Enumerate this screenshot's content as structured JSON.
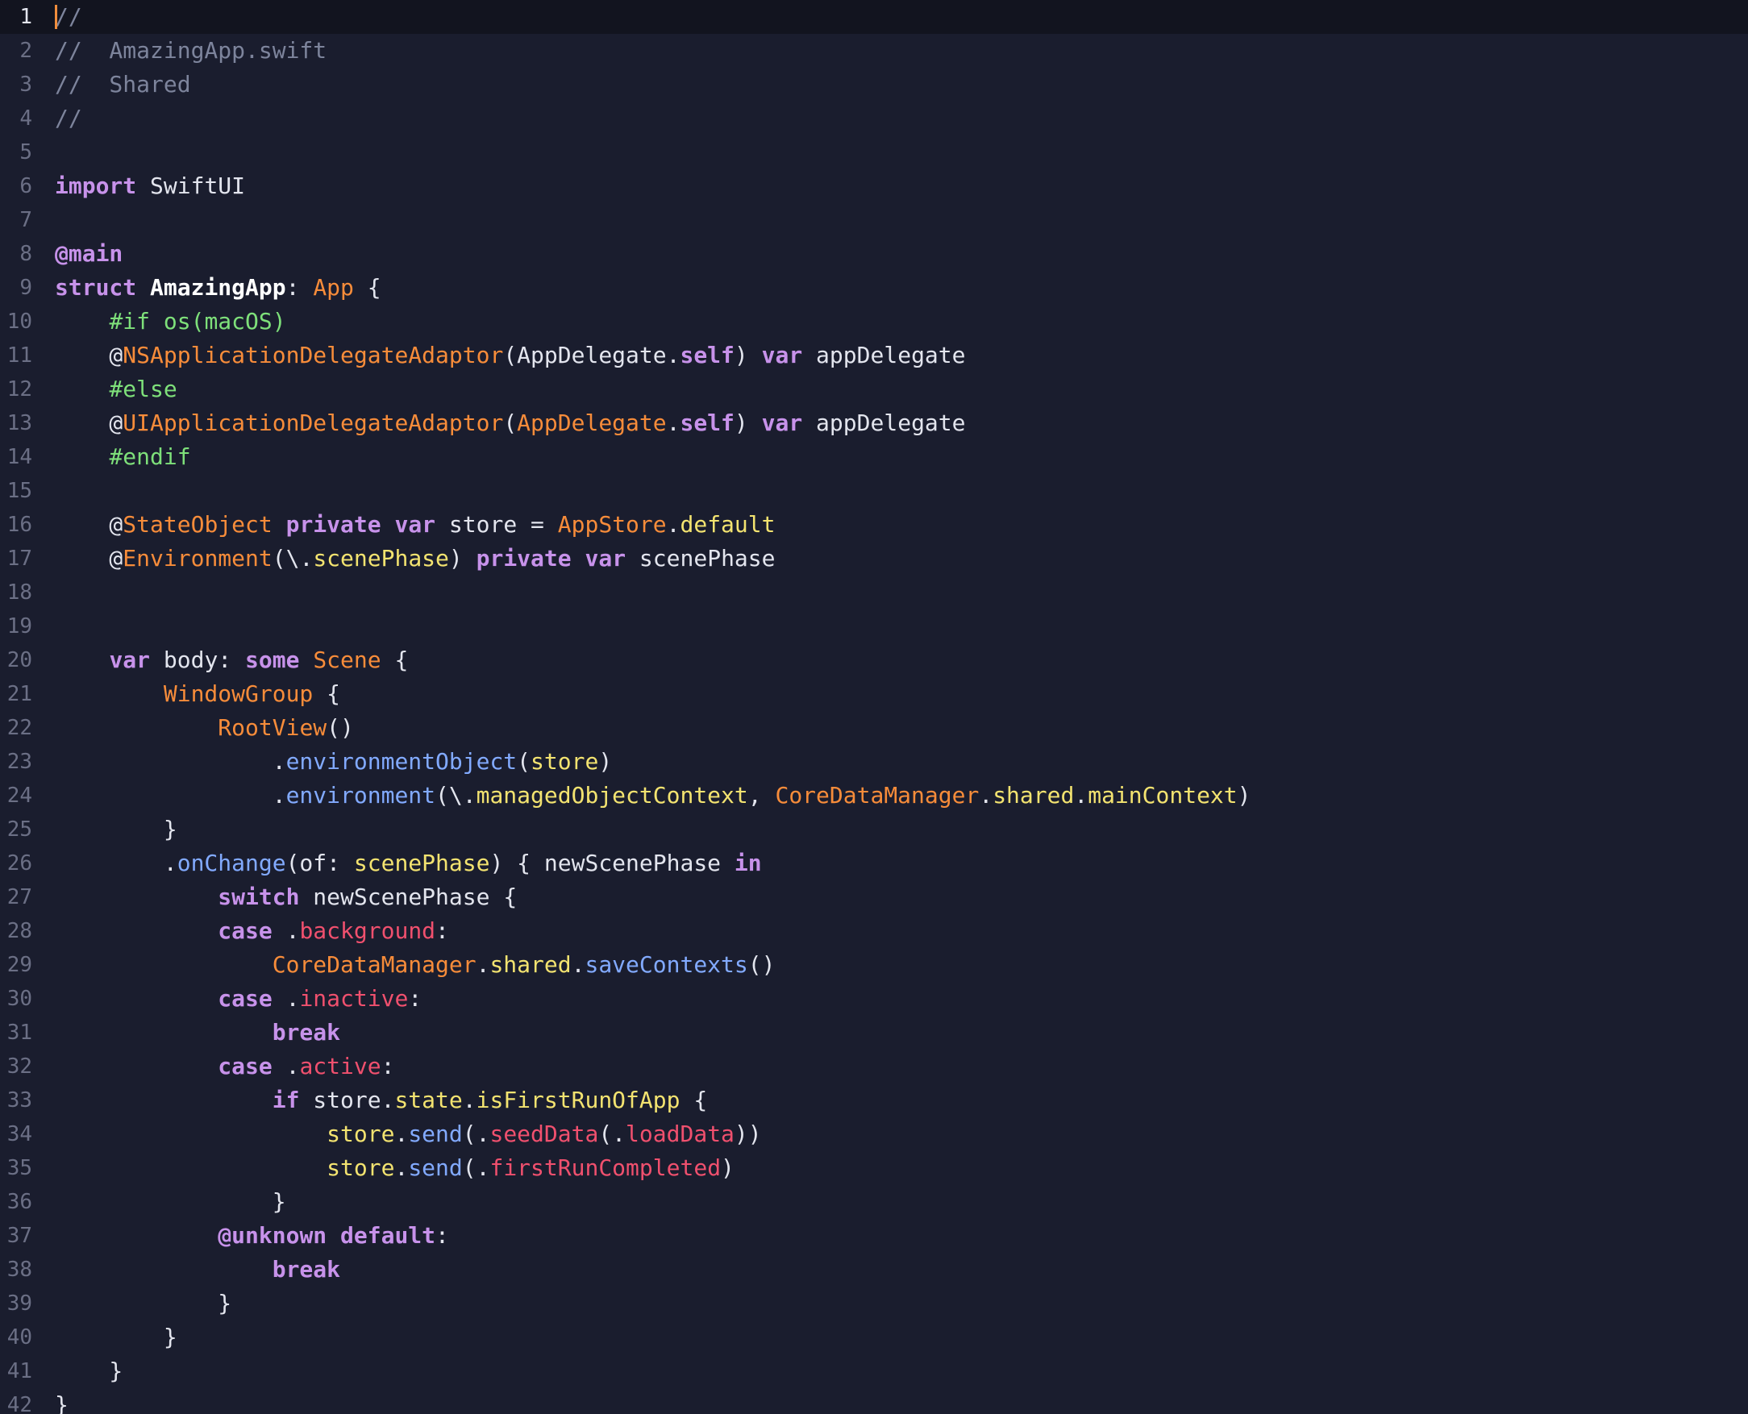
{
  "editor": {
    "file": "AmazingApp.swift",
    "current_line": 1,
    "colors": {
      "background": "#1a1d2e",
      "current_line_background": "#12141f",
      "comment": "#7d849c",
      "keyword": "#c792ea",
      "type": "#f78c3a",
      "property": "#f3e370",
      "function": "#82aaff",
      "enum_case": "#f0506e",
      "preprocessor": "#7ee07a",
      "plain": "#e3e5ee"
    },
    "lines": [
      {
        "num": "1",
        "tokens": [
          {
            "t": "//",
            "c": "comment"
          }
        ]
      },
      {
        "num": "2",
        "tokens": [
          {
            "t": "//  AmazingApp.swift",
            "c": "comment"
          }
        ]
      },
      {
        "num": "3",
        "tokens": [
          {
            "t": "//  Shared",
            "c": "comment"
          }
        ]
      },
      {
        "num": "4",
        "tokens": [
          {
            "t": "//",
            "c": "comment"
          }
        ]
      },
      {
        "num": "5",
        "tokens": []
      },
      {
        "num": "6",
        "tokens": [
          {
            "t": "import",
            "c": "kw"
          },
          {
            "t": " SwiftUI",
            "c": "plain"
          }
        ]
      },
      {
        "num": "7",
        "tokens": []
      },
      {
        "num": "8",
        "tokens": [
          {
            "t": "@main",
            "c": "kw"
          }
        ]
      },
      {
        "num": "9",
        "tokens": [
          {
            "t": "struct",
            "c": "kw"
          },
          {
            "t": " ",
            "c": "plain"
          },
          {
            "t": "AmazingApp",
            "c": "decl"
          },
          {
            "t": ": ",
            "c": "plain"
          },
          {
            "t": "App",
            "c": "type"
          },
          {
            "t": " {",
            "c": "plain"
          }
        ]
      },
      {
        "num": "10",
        "tokens": [
          {
            "t": "    ",
            "c": "plain"
          },
          {
            "t": "#if",
            "c": "pre"
          },
          {
            "t": " ",
            "c": "plain"
          },
          {
            "t": "os(macOS)",
            "c": "pre"
          }
        ]
      },
      {
        "num": "11",
        "tokens": [
          {
            "t": "    @",
            "c": "plain"
          },
          {
            "t": "NSApplicationDelegateAdaptor",
            "c": "type"
          },
          {
            "t": "(AppDelegate.",
            "c": "plain"
          },
          {
            "t": "self",
            "c": "kw"
          },
          {
            "t": ") ",
            "c": "plain"
          },
          {
            "t": "var",
            "c": "kw"
          },
          {
            "t": " appDelegate",
            "c": "plain"
          }
        ]
      },
      {
        "num": "12",
        "tokens": [
          {
            "t": "    ",
            "c": "plain"
          },
          {
            "t": "#else",
            "c": "pre"
          }
        ]
      },
      {
        "num": "13",
        "tokens": [
          {
            "t": "    @",
            "c": "plain"
          },
          {
            "t": "UIApplicationDelegateAdaptor",
            "c": "type"
          },
          {
            "t": "(",
            "c": "plain"
          },
          {
            "t": "AppDelegate",
            "c": "type"
          },
          {
            "t": ".",
            "c": "plain"
          },
          {
            "t": "self",
            "c": "kw"
          },
          {
            "t": ") ",
            "c": "plain"
          },
          {
            "t": "var",
            "c": "kw"
          },
          {
            "t": " appDelegate",
            "c": "plain"
          }
        ]
      },
      {
        "num": "14",
        "tokens": [
          {
            "t": "    ",
            "c": "plain"
          },
          {
            "t": "#endif",
            "c": "pre"
          }
        ]
      },
      {
        "num": "15",
        "tokens": []
      },
      {
        "num": "16",
        "tokens": [
          {
            "t": "    @",
            "c": "plain"
          },
          {
            "t": "StateObject",
            "c": "type"
          },
          {
            "t": " ",
            "c": "plain"
          },
          {
            "t": "private",
            "c": "kw"
          },
          {
            "t": " ",
            "c": "plain"
          },
          {
            "t": "var",
            "c": "kw"
          },
          {
            "t": " store = ",
            "c": "plain"
          },
          {
            "t": "AppStore",
            "c": "type"
          },
          {
            "t": ".",
            "c": "plain"
          },
          {
            "t": "default",
            "c": "prop"
          }
        ]
      },
      {
        "num": "17",
        "tokens": [
          {
            "t": "    @",
            "c": "plain"
          },
          {
            "t": "Environment",
            "c": "type"
          },
          {
            "t": "(\\.",
            "c": "plain"
          },
          {
            "t": "scenePhase",
            "c": "prop"
          },
          {
            "t": ") ",
            "c": "plain"
          },
          {
            "t": "private",
            "c": "kw"
          },
          {
            "t": " ",
            "c": "plain"
          },
          {
            "t": "var",
            "c": "kw"
          },
          {
            "t": " scenePhase",
            "c": "plain"
          }
        ]
      },
      {
        "num": "18",
        "tokens": []
      },
      {
        "num": "19",
        "tokens": []
      },
      {
        "num": "20",
        "tokens": [
          {
            "t": "    ",
            "c": "plain"
          },
          {
            "t": "var",
            "c": "kw"
          },
          {
            "t": " body: ",
            "c": "plain"
          },
          {
            "t": "some",
            "c": "kw"
          },
          {
            "t": " ",
            "c": "plain"
          },
          {
            "t": "Scene",
            "c": "type"
          },
          {
            "t": " {",
            "c": "plain"
          }
        ]
      },
      {
        "num": "21",
        "tokens": [
          {
            "t": "        ",
            "c": "plain"
          },
          {
            "t": "WindowGroup",
            "c": "type"
          },
          {
            "t": " {",
            "c": "plain"
          }
        ]
      },
      {
        "num": "22",
        "tokens": [
          {
            "t": "            ",
            "c": "plain"
          },
          {
            "t": "RootView",
            "c": "type"
          },
          {
            "t": "()",
            "c": "plain"
          }
        ]
      },
      {
        "num": "23",
        "tokens": [
          {
            "t": "                .",
            "c": "plain"
          },
          {
            "t": "environmentObject",
            "c": "func"
          },
          {
            "t": "(",
            "c": "plain"
          },
          {
            "t": "store",
            "c": "prop"
          },
          {
            "t": ")",
            "c": "plain"
          }
        ]
      },
      {
        "num": "24",
        "tokens": [
          {
            "t": "                .",
            "c": "plain"
          },
          {
            "t": "environment",
            "c": "func"
          },
          {
            "t": "(\\.",
            "c": "plain"
          },
          {
            "t": "managedObjectContext",
            "c": "prop"
          },
          {
            "t": ", ",
            "c": "plain"
          },
          {
            "t": "CoreDataManager",
            "c": "type"
          },
          {
            "t": ".",
            "c": "plain"
          },
          {
            "t": "shared",
            "c": "prop"
          },
          {
            "t": ".",
            "c": "plain"
          },
          {
            "t": "mainContext",
            "c": "prop"
          },
          {
            "t": ")",
            "c": "plain"
          }
        ]
      },
      {
        "num": "25",
        "tokens": [
          {
            "t": "        }",
            "c": "plain"
          }
        ]
      },
      {
        "num": "26",
        "tokens": [
          {
            "t": "        .",
            "c": "plain"
          },
          {
            "t": "onChange",
            "c": "func"
          },
          {
            "t": "(of: ",
            "c": "plain"
          },
          {
            "t": "scenePhase",
            "c": "prop"
          },
          {
            "t": ") { newScenePhase ",
            "c": "plain"
          },
          {
            "t": "in",
            "c": "kw"
          }
        ]
      },
      {
        "num": "27",
        "tokens": [
          {
            "t": "            ",
            "c": "plain"
          },
          {
            "t": "switch",
            "c": "kw"
          },
          {
            "t": " newScenePhase {",
            "c": "plain"
          }
        ]
      },
      {
        "num": "28",
        "tokens": [
          {
            "t": "            ",
            "c": "plain"
          },
          {
            "t": "case",
            "c": "kw"
          },
          {
            "t": " .",
            "c": "plain"
          },
          {
            "t": "background",
            "c": "case"
          },
          {
            "t": ":",
            "c": "plain"
          }
        ]
      },
      {
        "num": "29",
        "tokens": [
          {
            "t": "                ",
            "c": "plain"
          },
          {
            "t": "CoreDataManager",
            "c": "type"
          },
          {
            "t": ".",
            "c": "plain"
          },
          {
            "t": "shared",
            "c": "prop"
          },
          {
            "t": ".",
            "c": "plain"
          },
          {
            "t": "saveContexts",
            "c": "func"
          },
          {
            "t": "()",
            "c": "plain"
          }
        ]
      },
      {
        "num": "30",
        "tokens": [
          {
            "t": "            ",
            "c": "plain"
          },
          {
            "t": "case",
            "c": "kw"
          },
          {
            "t": " .",
            "c": "plain"
          },
          {
            "t": "inactive",
            "c": "case"
          },
          {
            "t": ":",
            "c": "plain"
          }
        ]
      },
      {
        "num": "31",
        "tokens": [
          {
            "t": "                ",
            "c": "plain"
          },
          {
            "t": "break",
            "c": "kw"
          }
        ]
      },
      {
        "num": "32",
        "tokens": [
          {
            "t": "            ",
            "c": "plain"
          },
          {
            "t": "case",
            "c": "kw"
          },
          {
            "t": " .",
            "c": "plain"
          },
          {
            "t": "active",
            "c": "case"
          },
          {
            "t": ":",
            "c": "plain"
          }
        ]
      },
      {
        "num": "33",
        "tokens": [
          {
            "t": "                ",
            "c": "plain"
          },
          {
            "t": "if",
            "c": "kw"
          },
          {
            "t": " store.",
            "c": "plain"
          },
          {
            "t": "state",
            "c": "prop"
          },
          {
            "t": ".",
            "c": "plain"
          },
          {
            "t": "isFirstRunOfApp",
            "c": "prop"
          },
          {
            "t": " {",
            "c": "plain"
          }
        ]
      },
      {
        "num": "34",
        "tokens": [
          {
            "t": "                    ",
            "c": "plain"
          },
          {
            "t": "store",
            "c": "prop"
          },
          {
            "t": ".",
            "c": "plain"
          },
          {
            "t": "send",
            "c": "func"
          },
          {
            "t": "(.",
            "c": "plain"
          },
          {
            "t": "seedData",
            "c": "case"
          },
          {
            "t": "(.",
            "c": "plain"
          },
          {
            "t": "loadData",
            "c": "case"
          },
          {
            "t": "))",
            "c": "plain"
          }
        ]
      },
      {
        "num": "35",
        "tokens": [
          {
            "t": "                    ",
            "c": "plain"
          },
          {
            "t": "store",
            "c": "prop"
          },
          {
            "t": ".",
            "c": "plain"
          },
          {
            "t": "send",
            "c": "func"
          },
          {
            "t": "(.",
            "c": "plain"
          },
          {
            "t": "firstRunCompleted",
            "c": "case"
          },
          {
            "t": ")",
            "c": "plain"
          }
        ]
      },
      {
        "num": "36",
        "tokens": [
          {
            "t": "                }",
            "c": "plain"
          }
        ]
      },
      {
        "num": "37",
        "tokens": [
          {
            "t": "            ",
            "c": "plain"
          },
          {
            "t": "@unknown",
            "c": "kw"
          },
          {
            "t": " ",
            "c": "plain"
          },
          {
            "t": "default",
            "c": "kw"
          },
          {
            "t": ":",
            "c": "plain"
          }
        ]
      },
      {
        "num": "38",
        "tokens": [
          {
            "t": "                ",
            "c": "plain"
          },
          {
            "t": "break",
            "c": "kw"
          }
        ]
      },
      {
        "num": "39",
        "tokens": [
          {
            "t": "            }",
            "c": "plain"
          }
        ]
      },
      {
        "num": "40",
        "tokens": [
          {
            "t": "        }",
            "c": "plain"
          }
        ]
      },
      {
        "num": "41",
        "tokens": [
          {
            "t": "    }",
            "c": "plain"
          }
        ]
      },
      {
        "num": "42",
        "tokens": [
          {
            "t": "}",
            "c": "plain"
          }
        ]
      }
    ]
  }
}
